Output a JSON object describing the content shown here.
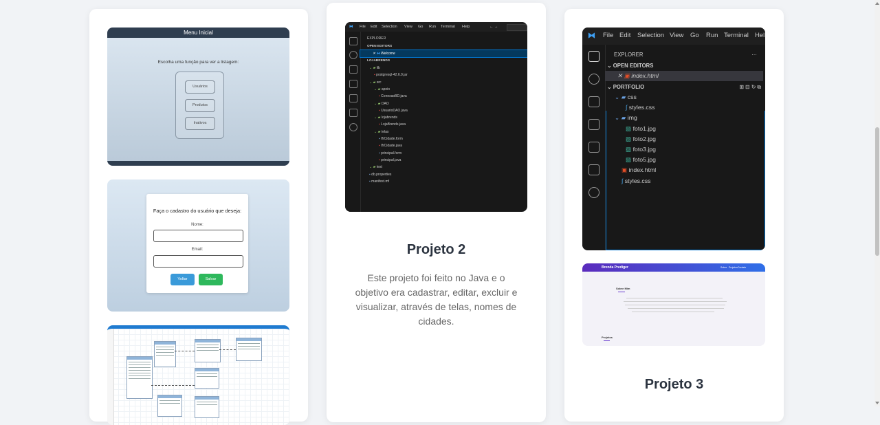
{
  "card1": {
    "menu_screenshot": {
      "title": "Menu Inicial",
      "prompt": "Escolha uma função para ver a listagem:",
      "buttons": [
        "Usuários",
        "Produtos",
        "Inativos"
      ]
    },
    "cadastro_screenshot": {
      "title": "Faça o cadastro do usuário que deseja:",
      "label_nome": "Nome:",
      "label_email": "Email:",
      "btn_voltar": "Voltar",
      "btn_salvar": "Salvar"
    }
  },
  "card2": {
    "title": "Projeto 2",
    "description": "Este projeto foi feito no Java e o objetivo era cadastrar, editar, excluir e visualizar, através de telas, nomes de cidades.",
    "ide": {
      "menu": [
        "File",
        "Edit",
        "Selection",
        "View",
        "Go",
        "Run",
        "Terminal",
        "Help"
      ],
      "explorer": "EXPLORER",
      "open_editors": "OPEN EDITORS",
      "open_file": "Welcome",
      "project": "LOJABRENDS",
      "tree": [
        {
          "label": "lib",
          "level": 1,
          "kind": "folder"
        },
        {
          "label": "postgresql-42.6.0.jar",
          "level": 2,
          "kind": "file"
        },
        {
          "label": "src",
          "level": 1,
          "kind": "folder"
        },
        {
          "label": "apoio",
          "level": 2,
          "kind": "folder"
        },
        {
          "label": "ConexaoBD.java",
          "level": 3,
          "kind": "file"
        },
        {
          "label": "DAO",
          "level": 2,
          "kind": "folder"
        },
        {
          "label": "UsuarioDAO.java",
          "level": 3,
          "kind": "file"
        },
        {
          "label": "lojabrends",
          "level": 2,
          "kind": "folder"
        },
        {
          "label": "LojaBrends.java",
          "level": 3,
          "kind": "file"
        },
        {
          "label": "telas",
          "level": 2,
          "kind": "folder"
        },
        {
          "label": "IfrCidade.form",
          "level": 3,
          "kind": "file"
        },
        {
          "label": "IfrCidade.java",
          "level": 3,
          "kind": "file"
        },
        {
          "label": "principal.form",
          "level": 3,
          "kind": "file"
        },
        {
          "label": "principal.java",
          "level": 3,
          "kind": "file"
        },
        {
          "label": "test",
          "level": 1,
          "kind": "folder"
        },
        {
          "label": "db.properties",
          "level": 1,
          "kind": "file"
        },
        {
          "label": "manifest.mf",
          "level": 1,
          "kind": "file"
        }
      ]
    }
  },
  "card3": {
    "title": "Projeto 3",
    "ide": {
      "menu": [
        "File",
        "Edit",
        "Selection",
        "View",
        "Go",
        "Run",
        "Terminal",
        "Hel"
      ],
      "explorer": "EXPLORER",
      "open_editors": "OPEN EDITORS",
      "open_file": "index.html",
      "project": "PORTFOLIO",
      "tree": [
        {
          "label": "css",
          "level": 1,
          "kind": "folder"
        },
        {
          "label": "styles.css",
          "level": 2,
          "kind": "css"
        },
        {
          "label": "img",
          "level": 1,
          "kind": "folder"
        },
        {
          "label": "foto1.jpg",
          "level": 2,
          "kind": "img"
        },
        {
          "label": "foto2.jpg",
          "level": 2,
          "kind": "img"
        },
        {
          "label": "foto3.jpg",
          "level": 2,
          "kind": "img"
        },
        {
          "label": "foto5.jpg",
          "level": 2,
          "kind": "img"
        },
        {
          "label": "index.html",
          "level": 1,
          "kind": "html"
        },
        {
          "label": "styles.css",
          "level": 1,
          "kind": "css"
        }
      ]
    },
    "site": {
      "brand": "Brenda Prediger",
      "nav": [
        "Sobre",
        "Projetos",
        "Contato"
      ],
      "section_title": "Sobre Mim",
      "projects_title": "Projetos"
    }
  },
  "colors": {
    "accent_blue": "#0078d4",
    "button_blue": "#3a9ad9",
    "button_green": "#2eb85c",
    "title_text": "#2c3440"
  }
}
